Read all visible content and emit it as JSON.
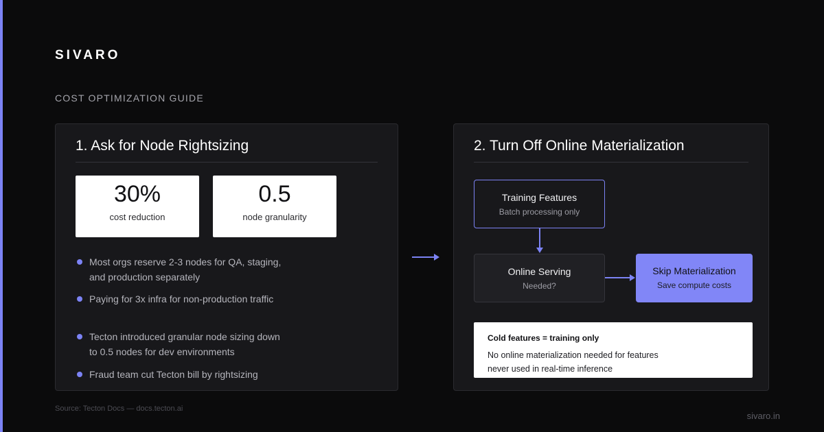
{
  "brand": "SIVARO",
  "guide_label": "COST OPTIMIZATION GUIDE",
  "colors": {
    "accent": "#7c83f5",
    "background": "#0b0b0c",
    "card": "#18181b"
  },
  "left_card": {
    "title": "1. Ask for Node Rightsizing",
    "stats": [
      {
        "value": "30%",
        "label": "cost reduction"
      },
      {
        "value": "0.5",
        "label": "node granularity"
      }
    ],
    "bullets": [
      "Most orgs reserve 2-3 nodes for QA, staging, and production separately",
      "Paying for 3x infra for non-production traffic",
      "Tecton introduced granular node sizing down to 0.5 nodes for dev environments",
      "Fraud team cut Tecton bill by rightsizing"
    ]
  },
  "connector_icon": "arrow-right-icon",
  "right_card": {
    "title": "2. Turn Off Online Materialization",
    "flow": {
      "training": {
        "title": "Training Features",
        "subtitle": "Batch processing only"
      },
      "serving": {
        "title": "Online Serving",
        "subtitle": "Needed?"
      },
      "skip": {
        "title": "Skip Materialization",
        "subtitle": "Save compute costs"
      }
    },
    "note": {
      "title": "Cold features = training only",
      "body": "No online materialization needed for features never used in real-time inference"
    }
  },
  "source": "Source: Tecton Docs — docs.tecton.ai",
  "footer_url": "sivaro.in"
}
